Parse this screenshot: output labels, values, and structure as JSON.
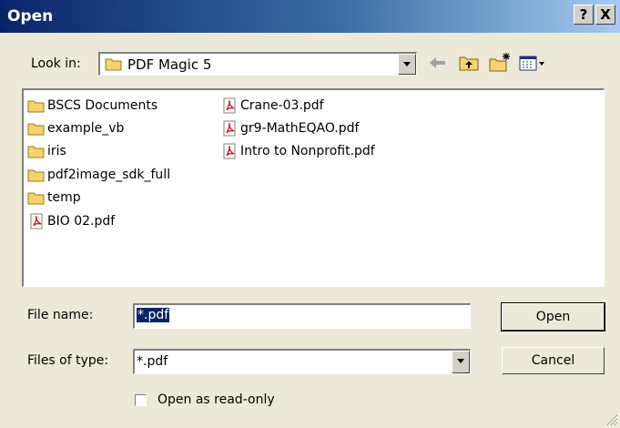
{
  "window": {
    "title": "Open",
    "help_label": "?",
    "close_label": "X"
  },
  "look_in": {
    "label": "Look in:",
    "value": "PDF Magic 5"
  },
  "toolbar": {
    "icons": [
      "back-arrow-icon",
      "up-folder-icon",
      "new-folder-icon",
      "view-menu-icon"
    ]
  },
  "files": {
    "col1": [
      {
        "name": "BSCS Documents",
        "type": "folder"
      },
      {
        "name": "example_vb",
        "type": "folder"
      },
      {
        "name": "iris",
        "type": "folder"
      },
      {
        "name": "pdf2image_sdk_full",
        "type": "folder"
      },
      {
        "name": "temp",
        "type": "folder"
      },
      {
        "name": "BIO 02.pdf",
        "type": "pdf"
      }
    ],
    "col2": [
      {
        "name": "Crane-03.pdf",
        "type": "pdf"
      },
      {
        "name": "gr9-MathEQAO.pdf",
        "type": "pdf"
      },
      {
        "name": "Intro to Nonprofit.pdf",
        "type": "pdf"
      }
    ]
  },
  "filename": {
    "label": "File name:",
    "value": "*.pdf"
  },
  "filetype": {
    "label": "Files of type:",
    "value": "*.pdf"
  },
  "buttons": {
    "open": "Open",
    "cancel": "Cancel"
  },
  "readonly": {
    "label": "Open as read-only",
    "checked": false
  }
}
